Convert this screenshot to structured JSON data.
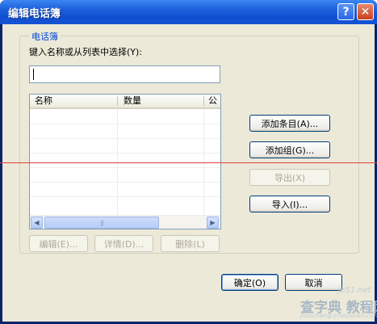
{
  "window": {
    "title": "编辑电话簿",
    "help_glyph": "?",
    "close_glyph": "✕"
  },
  "group": {
    "legend": "电话簿",
    "search_label": "键入名称或从列表中选择(Y):",
    "search_value": ""
  },
  "list": {
    "columns": [
      "名称",
      "数量",
      "公"
    ],
    "rows": []
  },
  "scrollbar": {
    "left_arrow": "◀",
    "right_arrow": "▶",
    "thumb_grip": "|||"
  },
  "buttons": {
    "add_entry": "添加条目(A)...",
    "add_group": "添加组(G)...",
    "export": "导出(X)",
    "import": "导入(I)...",
    "edit": "编辑(E)...",
    "details": "详情(D)...",
    "delete": "删除(L)",
    "ok": "确定(O)",
    "cancel": "取消"
  },
  "watermark": {
    "site": "jb51.net",
    "text": "查字典 教程网",
    "url": "jiaocheng.chazidian.com"
  },
  "colors": {
    "title_bar": "#1f63dd",
    "dialog_bg": "#ece9d8",
    "legend_text": "#0046d5",
    "annotation_line": "#e04040"
  }
}
